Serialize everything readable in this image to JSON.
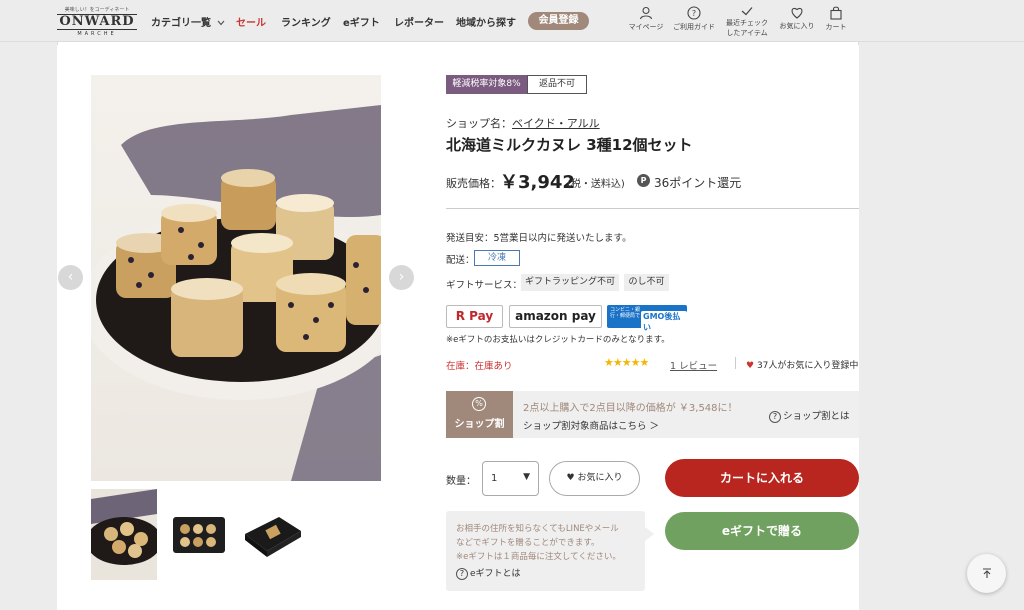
{
  "header": {
    "logo_tagline": "美味しい！をコーディネート",
    "logo_brand": "ONWARD",
    "logo_sub": "MARCHE",
    "nav": [
      {
        "label": "カテゴリ一覧",
        "has_chevron": true
      },
      {
        "label": "セール"
      },
      {
        "label": "ランキング"
      },
      {
        "label": "eギフト"
      },
      {
        "label": "レポーター"
      },
      {
        "label": "地域から探す"
      }
    ],
    "member_button": "会員登録",
    "icons": [
      {
        "icon": "person-icon",
        "label": "マイページ"
      },
      {
        "icon": "question-icon",
        "label": "ご利用ガイド"
      },
      {
        "icon": "check-icon",
        "label": "最近チェック",
        "label2": "したアイテム"
      },
      {
        "icon": "heart-icon",
        "label": "お気に入り"
      },
      {
        "icon": "bag-icon",
        "label": "カート"
      }
    ]
  },
  "product": {
    "badges": [
      "軽減税率対象8%",
      "返品不可"
    ],
    "shop_prefix": "ショップ名：",
    "shop_name": "ベイクド・アルル",
    "title": "北海道ミルクカヌレ 3種12個セット",
    "price_label": "販売価格：",
    "price": "￥3,942",
    "tax_note": "(税・送料込)",
    "points_icon": "P",
    "points": "36ポイント還元",
    "ship_estimate": "発送目安：5営業日以内に発送いたします。",
    "delivery_label": "配送：",
    "delivery_value": "冷凍",
    "gift_service_label": "ギフトサービス：",
    "gift_services": [
      "ギフトラッピング不可",
      "のし不可"
    ],
    "payments": [
      "R Pay",
      "amazon pay"
    ],
    "gmo_line1": "コンビニ・銀行・郵便局で",
    "gmo_line2": "GMO後払い",
    "payment_note": "※eギフトのお支払いはクレジットカードのみとなります。",
    "stock": "在庫：在庫あり",
    "stars": "★★★★★",
    "rating": 5,
    "review_link": "1 レビュー",
    "favorites_count": "37人がお気に入り登録中"
  },
  "shop_discount": {
    "icon": "%",
    "label": "ショップ割",
    "main_text": "2点以上購入で2点目以降の価格が ￥3,548に！",
    "sub_link": "ショップ割対象商品はこちら ＞",
    "help": "ショップ割とは"
  },
  "purchase": {
    "qty_label": "数量：",
    "qty_value": "1",
    "favorite_button": "お気に入り",
    "cart_button": "カートに入れる",
    "gift_button": "eギフトで贈る"
  },
  "egift_box": {
    "line1": "お相手の住所を知らなくてもLINEやメール",
    "line2": "などでギフトを贈ることができます。",
    "line3": "※eギフトは１商品毎に注文してください。",
    "help": "eギフトとは"
  },
  "colors": {
    "accent_brown": "#a0887a",
    "cart_red": "#b8261f",
    "gift_green": "#71a160",
    "tax_badge_purple": "#7b5b7f",
    "star_gold": "#f2b705"
  }
}
